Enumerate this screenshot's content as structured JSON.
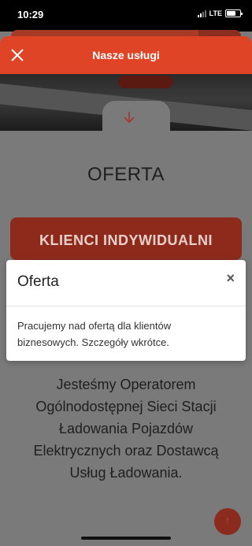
{
  "status_bar": {
    "time": "10:29",
    "network": "LTE"
  },
  "header": {
    "title": "Nasze usługi",
    "close_icon": "close-icon"
  },
  "page": {
    "offer_heading": "OFERTA",
    "individual_button": "KLIENCI INDYWIDUALNI",
    "about_text": "Jesteśmy Operatorem Ogólnodostępnej Sieci Stacji Ładowania Pojazdów Elektrycznych oraz Dostawcą Usług Ładowania."
  },
  "modal": {
    "title": "Oferta",
    "close_label": "×",
    "body": "Pracujemy nad ofertą dla klientów biznesowych. Szczegóły wkrótce."
  },
  "colors": {
    "accent": "#e04427",
    "button_dimmed": "#8e2a1c",
    "overlay": "#7a7a7a"
  }
}
